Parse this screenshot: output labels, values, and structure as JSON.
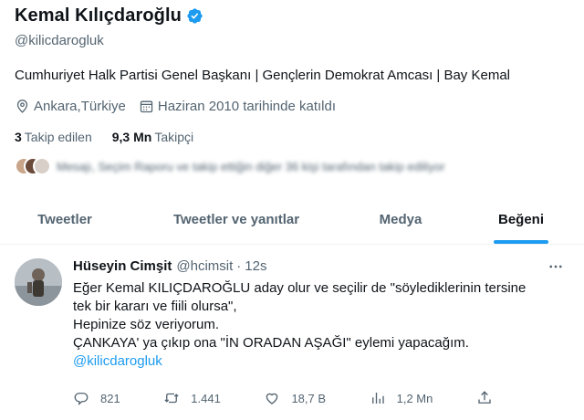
{
  "profile": {
    "display_name": "Kemal Kılıçdaroğlu",
    "handle": "@kilicdarogluk",
    "bio": "Cumhuriyet Halk Partisi Genel Başkanı | Gençlerin Demokrat Amcası | Bay Kemal",
    "location": "Ankara,Türkiye",
    "joined": "Haziran 2010 tarihinde katıldı",
    "following_count": "3",
    "following_label": "Takip edilen",
    "followers_count": "9,3 Mn",
    "followers_label": "Takipçi",
    "followed_by_text": "Mesajı, Seçim Raporu ve takip ettiğin diğer 36 kişi tarafından takip ediliyor",
    "verified_color": "#1d9bf0"
  },
  "tabs": [
    {
      "label": "Tweetler",
      "active": false
    },
    {
      "label": "Tweetler ve yanıtlar",
      "active": false
    },
    {
      "label": "Medya",
      "active": false
    },
    {
      "label": "Beğeni",
      "active": true
    }
  ],
  "tweet": {
    "author_name": "Hüseyin Cimşit",
    "author_handle": "@hcimsit",
    "separator": "·",
    "time": "12s",
    "lines": [
      "Eğer Kemal KILIÇDAROĞLU aday olur ve seçilir de \"söylediklerinin tersine",
      "tek bir kararı ve fiili olursa\",",
      "Hepinize söz veriyorum.",
      "ÇANKAYA' ya çıkıp ona \"İN ORADAN AŞAĞI\" eylemi yapacağım."
    ],
    "mention": "@kilicdarogluk",
    "replies": "821",
    "retweets": "1.441",
    "likes": "18,7 B",
    "views": "1,2 Mn"
  },
  "icons": {
    "location": "location-pin-icon",
    "calendar": "calendar-icon",
    "verified": "verified-badge-icon",
    "reply": "reply-icon",
    "retweet": "retweet-icon",
    "like": "heart-icon",
    "views": "views-chart-icon",
    "share": "share-icon",
    "more": "more-dots-icon"
  },
  "colors": {
    "accent": "#1d9bf0",
    "text_primary": "#0f1419",
    "text_secondary": "#536471"
  }
}
